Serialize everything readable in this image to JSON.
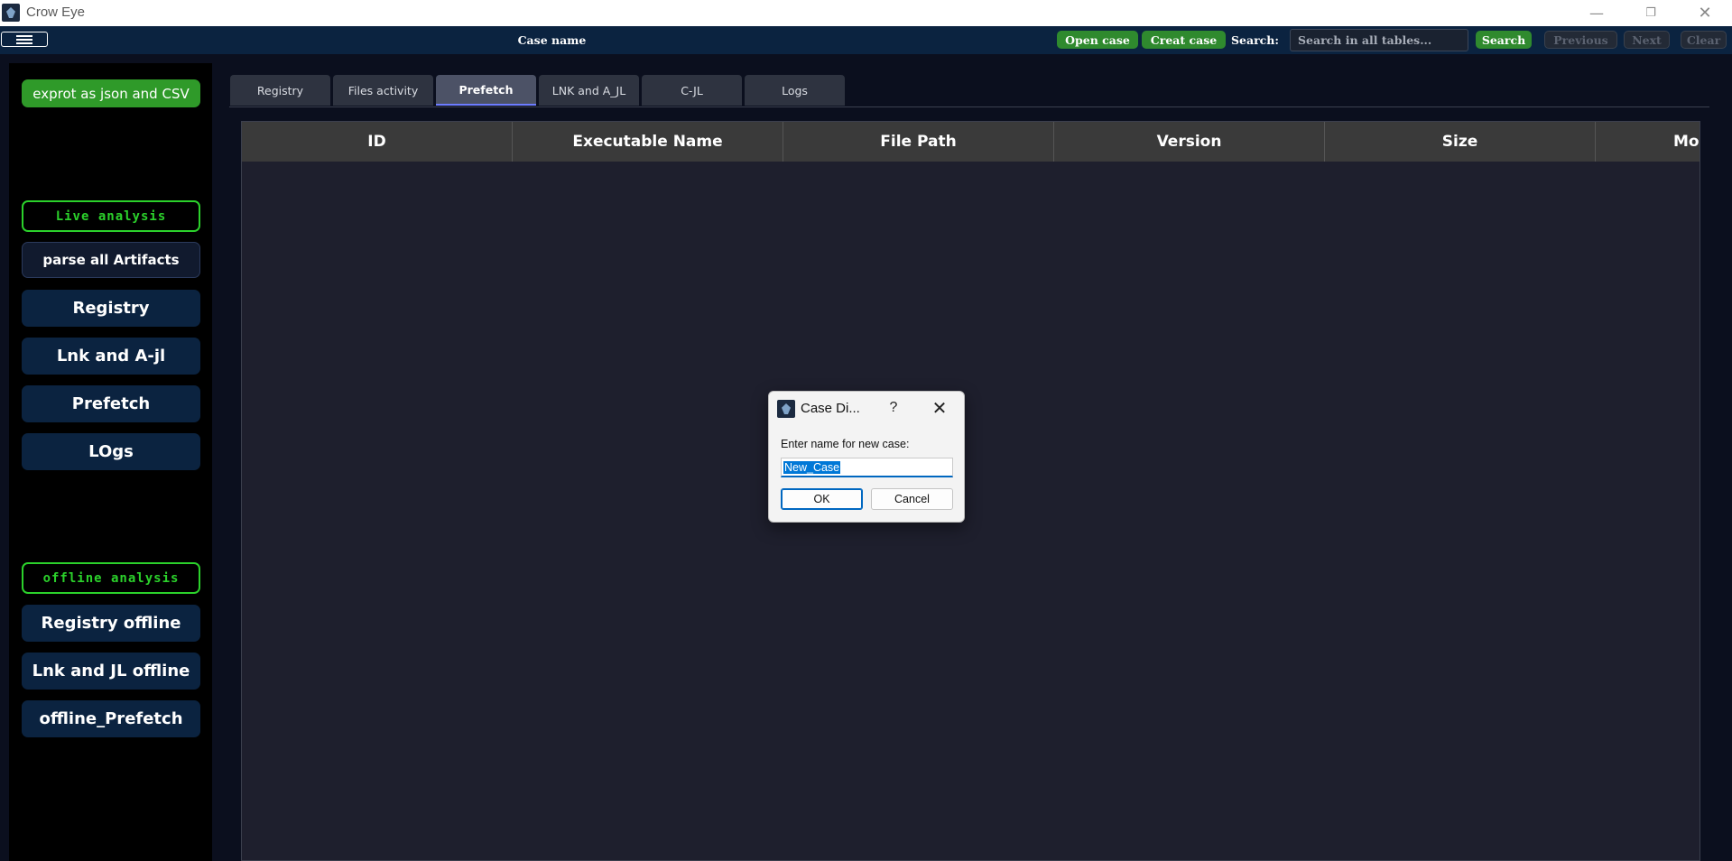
{
  "window": {
    "title": "Crow Eye",
    "minimize_glyph": "—",
    "maximize_glyph": "❐",
    "close_glyph": "✕"
  },
  "topbar": {
    "case_name": "Case name",
    "open_case": "Open case",
    "create_case": "Creat case",
    "search_label": "Search:",
    "search_placeholder": "Search in all tables...",
    "search_button": "Search",
    "previous": "Previous",
    "next": "Next",
    "clear": "Clear"
  },
  "sidebar": {
    "export": "exprot as json and CSV",
    "live_section": "Live analysis",
    "parse_all": "parse all Artifacts",
    "live_items": [
      "Registry",
      "Lnk and A-jl",
      "Prefetch",
      "LOgs"
    ],
    "offline_section": "offline analysis",
    "offline_items": [
      "Registry offline",
      "Lnk and JL offline",
      "offline_Prefetch"
    ]
  },
  "tabs": [
    {
      "label": "Registry",
      "active": false
    },
    {
      "label": "Files activity",
      "active": false
    },
    {
      "label": "Prefetch",
      "active": true
    },
    {
      "label": "LNK and A_JL",
      "active": false
    },
    {
      "label": "C-JL",
      "active": false
    },
    {
      "label": "Logs",
      "active": false
    }
  ],
  "table": {
    "columns": [
      "ID",
      "Executable Name",
      "File Path",
      "Version",
      "Size",
      "Mo"
    ]
  },
  "dialog": {
    "title": "Case Di...",
    "help": "?",
    "close": "✕",
    "label": "Enter name for new case:",
    "value": "New_Case",
    "ok": "OK",
    "cancel": "Cancel"
  },
  "colors": {
    "accent_green": "#2f8a2e",
    "section_green": "#2bd12b",
    "nav_blue": "#0b2340",
    "background": "#0b0f1e"
  },
  "icons": {
    "app": "crow-eye-logo-icon",
    "menu": "hamburger-menu-icon"
  }
}
